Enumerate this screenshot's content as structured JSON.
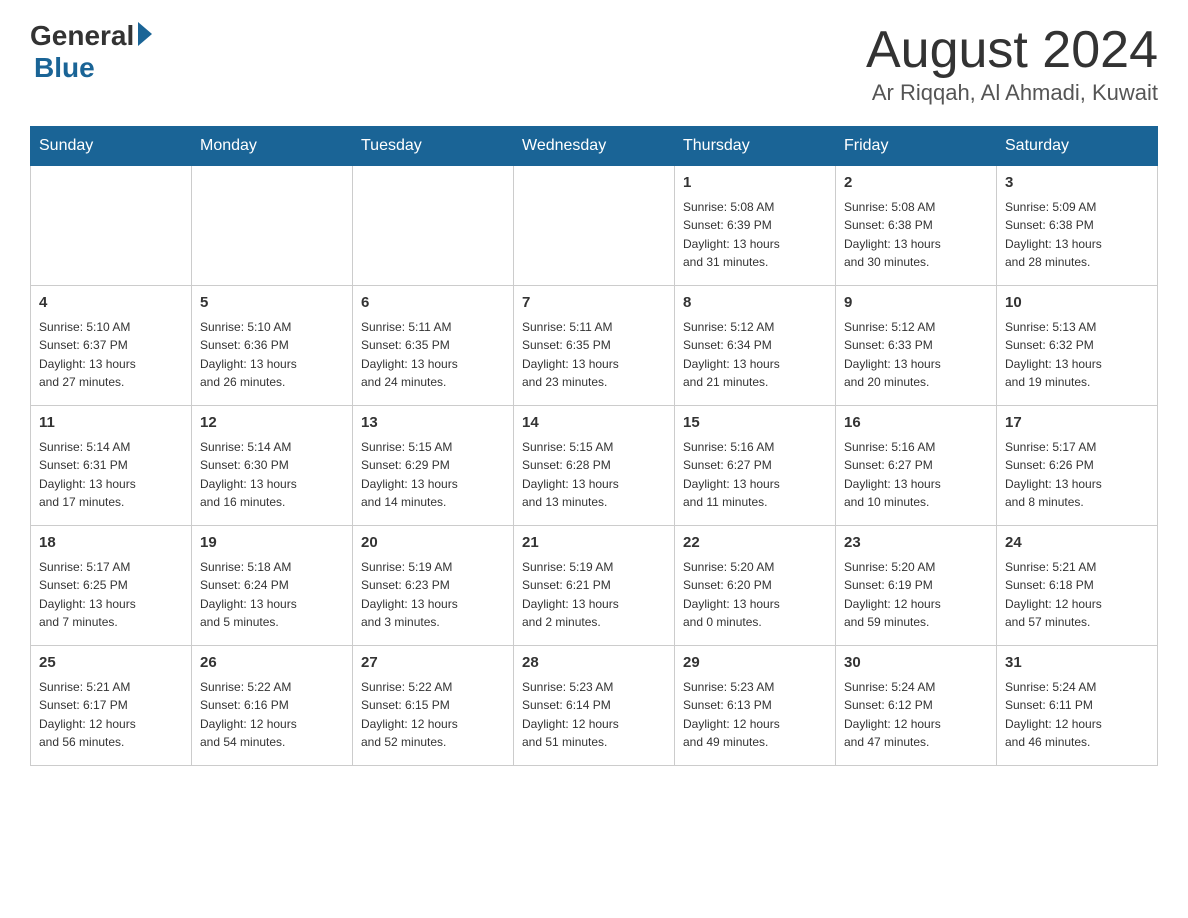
{
  "header": {
    "logo_general": "General",
    "logo_blue": "Blue",
    "month_year": "August 2024",
    "location": "Ar Riqqah, Al Ahmadi, Kuwait"
  },
  "days_of_week": [
    "Sunday",
    "Monday",
    "Tuesday",
    "Wednesday",
    "Thursday",
    "Friday",
    "Saturday"
  ],
  "weeks": [
    [
      {
        "day": "",
        "info": ""
      },
      {
        "day": "",
        "info": ""
      },
      {
        "day": "",
        "info": ""
      },
      {
        "day": "",
        "info": ""
      },
      {
        "day": "1",
        "info": "Sunrise: 5:08 AM\nSunset: 6:39 PM\nDaylight: 13 hours\nand 31 minutes."
      },
      {
        "day": "2",
        "info": "Sunrise: 5:08 AM\nSunset: 6:38 PM\nDaylight: 13 hours\nand 30 minutes."
      },
      {
        "day": "3",
        "info": "Sunrise: 5:09 AM\nSunset: 6:38 PM\nDaylight: 13 hours\nand 28 minutes."
      }
    ],
    [
      {
        "day": "4",
        "info": "Sunrise: 5:10 AM\nSunset: 6:37 PM\nDaylight: 13 hours\nand 27 minutes."
      },
      {
        "day": "5",
        "info": "Sunrise: 5:10 AM\nSunset: 6:36 PM\nDaylight: 13 hours\nand 26 minutes."
      },
      {
        "day": "6",
        "info": "Sunrise: 5:11 AM\nSunset: 6:35 PM\nDaylight: 13 hours\nand 24 minutes."
      },
      {
        "day": "7",
        "info": "Sunrise: 5:11 AM\nSunset: 6:35 PM\nDaylight: 13 hours\nand 23 minutes."
      },
      {
        "day": "8",
        "info": "Sunrise: 5:12 AM\nSunset: 6:34 PM\nDaylight: 13 hours\nand 21 minutes."
      },
      {
        "day": "9",
        "info": "Sunrise: 5:12 AM\nSunset: 6:33 PM\nDaylight: 13 hours\nand 20 minutes."
      },
      {
        "day": "10",
        "info": "Sunrise: 5:13 AM\nSunset: 6:32 PM\nDaylight: 13 hours\nand 19 minutes."
      }
    ],
    [
      {
        "day": "11",
        "info": "Sunrise: 5:14 AM\nSunset: 6:31 PM\nDaylight: 13 hours\nand 17 minutes."
      },
      {
        "day": "12",
        "info": "Sunrise: 5:14 AM\nSunset: 6:30 PM\nDaylight: 13 hours\nand 16 minutes."
      },
      {
        "day": "13",
        "info": "Sunrise: 5:15 AM\nSunset: 6:29 PM\nDaylight: 13 hours\nand 14 minutes."
      },
      {
        "day": "14",
        "info": "Sunrise: 5:15 AM\nSunset: 6:28 PM\nDaylight: 13 hours\nand 13 minutes."
      },
      {
        "day": "15",
        "info": "Sunrise: 5:16 AM\nSunset: 6:27 PM\nDaylight: 13 hours\nand 11 minutes."
      },
      {
        "day": "16",
        "info": "Sunrise: 5:16 AM\nSunset: 6:27 PM\nDaylight: 13 hours\nand 10 minutes."
      },
      {
        "day": "17",
        "info": "Sunrise: 5:17 AM\nSunset: 6:26 PM\nDaylight: 13 hours\nand 8 minutes."
      }
    ],
    [
      {
        "day": "18",
        "info": "Sunrise: 5:17 AM\nSunset: 6:25 PM\nDaylight: 13 hours\nand 7 minutes."
      },
      {
        "day": "19",
        "info": "Sunrise: 5:18 AM\nSunset: 6:24 PM\nDaylight: 13 hours\nand 5 minutes."
      },
      {
        "day": "20",
        "info": "Sunrise: 5:19 AM\nSunset: 6:23 PM\nDaylight: 13 hours\nand 3 minutes."
      },
      {
        "day": "21",
        "info": "Sunrise: 5:19 AM\nSunset: 6:21 PM\nDaylight: 13 hours\nand 2 minutes."
      },
      {
        "day": "22",
        "info": "Sunrise: 5:20 AM\nSunset: 6:20 PM\nDaylight: 13 hours\nand 0 minutes."
      },
      {
        "day": "23",
        "info": "Sunrise: 5:20 AM\nSunset: 6:19 PM\nDaylight: 12 hours\nand 59 minutes."
      },
      {
        "day": "24",
        "info": "Sunrise: 5:21 AM\nSunset: 6:18 PM\nDaylight: 12 hours\nand 57 minutes."
      }
    ],
    [
      {
        "day": "25",
        "info": "Sunrise: 5:21 AM\nSunset: 6:17 PM\nDaylight: 12 hours\nand 56 minutes."
      },
      {
        "day": "26",
        "info": "Sunrise: 5:22 AM\nSunset: 6:16 PM\nDaylight: 12 hours\nand 54 minutes."
      },
      {
        "day": "27",
        "info": "Sunrise: 5:22 AM\nSunset: 6:15 PM\nDaylight: 12 hours\nand 52 minutes."
      },
      {
        "day": "28",
        "info": "Sunrise: 5:23 AM\nSunset: 6:14 PM\nDaylight: 12 hours\nand 51 minutes."
      },
      {
        "day": "29",
        "info": "Sunrise: 5:23 AM\nSunset: 6:13 PM\nDaylight: 12 hours\nand 49 minutes."
      },
      {
        "day": "30",
        "info": "Sunrise: 5:24 AM\nSunset: 6:12 PM\nDaylight: 12 hours\nand 47 minutes."
      },
      {
        "day": "31",
        "info": "Sunrise: 5:24 AM\nSunset: 6:11 PM\nDaylight: 12 hours\nand 46 minutes."
      }
    ]
  ]
}
